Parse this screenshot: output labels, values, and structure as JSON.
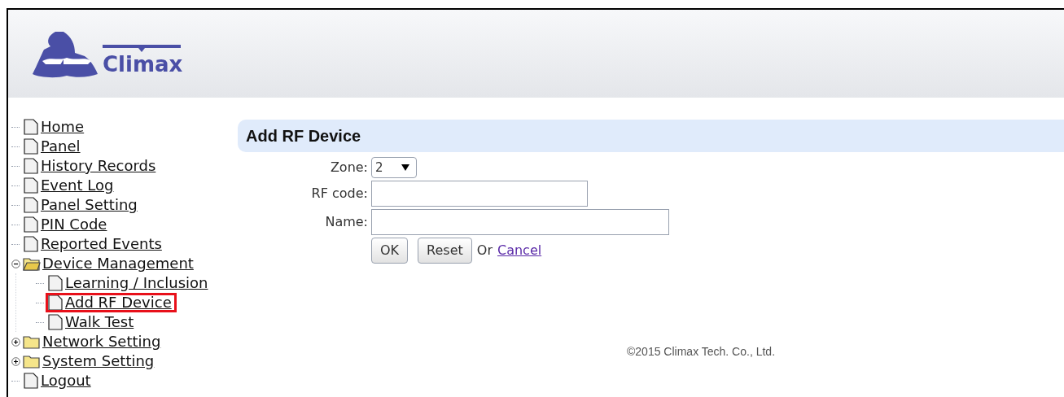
{
  "header": {
    "logo_text": "Climax"
  },
  "sidebar": {
    "items": [
      {
        "label": "Home",
        "kind": "page"
      },
      {
        "label": "Panel",
        "kind": "page"
      },
      {
        "label": "History Records",
        "kind": "page"
      },
      {
        "label": "Event Log",
        "kind": "page"
      },
      {
        "label": "Panel Setting",
        "kind": "page"
      },
      {
        "label": "PIN Code",
        "kind": "page"
      },
      {
        "label": "Reported Events",
        "kind": "page"
      },
      {
        "label": "Device Management",
        "kind": "folder",
        "expanded": true,
        "children": [
          {
            "label": "Learning / Inclusion",
            "kind": "page",
            "highlighted": false
          },
          {
            "label": "Add RF Device",
            "kind": "page",
            "highlighted": true
          },
          {
            "label": "Walk Test",
            "kind": "page",
            "highlighted": false
          }
        ]
      },
      {
        "label": "Network Setting",
        "kind": "folder",
        "expanded": false
      },
      {
        "label": "System Setting",
        "kind": "folder",
        "expanded": false
      },
      {
        "label": "Logout",
        "kind": "page"
      }
    ]
  },
  "main": {
    "title": "Add RF Device",
    "form": {
      "zone": {
        "label": "Zone:",
        "value": "2"
      },
      "rf_code": {
        "label": "RF code:"
      },
      "name": {
        "label": "Name:"
      },
      "ok": "OK",
      "reset": "Reset",
      "or": "Or",
      "cancel": "Cancel"
    },
    "footer": "©2015 Climax Tech. Co., Ltd."
  }
}
